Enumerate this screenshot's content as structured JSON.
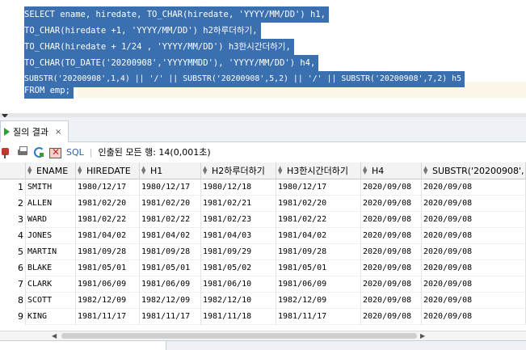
{
  "editor": {
    "lines": [
      "SELECT ename, hiredate, TO_CHAR(hiredate, 'YYYY/MM/DD') h1,",
      "TO_CHAR(hiredate +1, 'YYYY/MM/DD') h2하루더하기,",
      "TO_CHAR(hiredate + 1/24 , 'YYYY/MM/DD') h3한시간더하기,",
      "TO_CHAR(TO_DATE('20200908','YYYYMMDD'), 'YYYY/MM/DD') h4,",
      "SUBSTR('20200908',1,4) || '/' || SUBSTR('20200908',5,2) || '/' || SUBSTR('20200908',7,2) h5",
      "FROM emp;"
    ]
  },
  "results_tab": {
    "label": "질의 결과",
    "close": "×"
  },
  "toolbar": {
    "sql_label": "SQL",
    "separator": "|",
    "fetch_status": "인출된 모든 행: 14(0,001초)"
  },
  "grid": {
    "columns": [
      "ENAME",
      "HIREDATE",
      "H1",
      "H2하루더하기",
      "H3한시간더하기",
      "H4",
      "SUBSTR('20200908',"
    ],
    "rows": [
      [
        "1",
        "SMITH",
        "1980/12/17",
        "1980/12/17",
        "1980/12/18",
        "1980/12/17",
        "2020/09/08",
        "2020/09/08"
      ],
      [
        "2",
        "ALLEN",
        "1981/02/20",
        "1981/02/20",
        "1981/02/21",
        "1981/02/20",
        "2020/09/08",
        "2020/09/08"
      ],
      [
        "3",
        "WARD",
        "1981/02/22",
        "1981/02/22",
        "1981/02/23",
        "1981/02/22",
        "2020/09/08",
        "2020/09/08"
      ],
      [
        "4",
        "JONES",
        "1981/04/02",
        "1981/04/02",
        "1981/04/03",
        "1981/04/02",
        "2020/09/08",
        "2020/09/08"
      ],
      [
        "5",
        "MARTIN",
        "1981/09/28",
        "1981/09/28",
        "1981/09/29",
        "1981/09/28",
        "2020/09/08",
        "2020/09/08"
      ],
      [
        "6",
        "BLAKE",
        "1981/05/01",
        "1981/05/01",
        "1981/05/02",
        "1981/05/01",
        "2020/09/08",
        "2020/09/08"
      ],
      [
        "7",
        "CLARK",
        "1981/06/09",
        "1981/06/09",
        "1981/06/10",
        "1981/06/09",
        "2020/09/08",
        "2020/09/08"
      ],
      [
        "8",
        "SCOTT",
        "1982/12/09",
        "1982/12/09",
        "1982/12/10",
        "1982/12/09",
        "2020/09/08",
        "2020/09/08"
      ],
      [
        "9",
        "KING",
        "1981/11/17",
        "1981/11/17",
        "1981/11/18",
        "1981/11/17",
        "2020/09/08",
        "2020/09/08"
      ]
    ]
  },
  "colors": {
    "selection": "#3a6fb0",
    "run_icon": "#2f9e3a",
    "sql_link": "#2b5fa8"
  }
}
